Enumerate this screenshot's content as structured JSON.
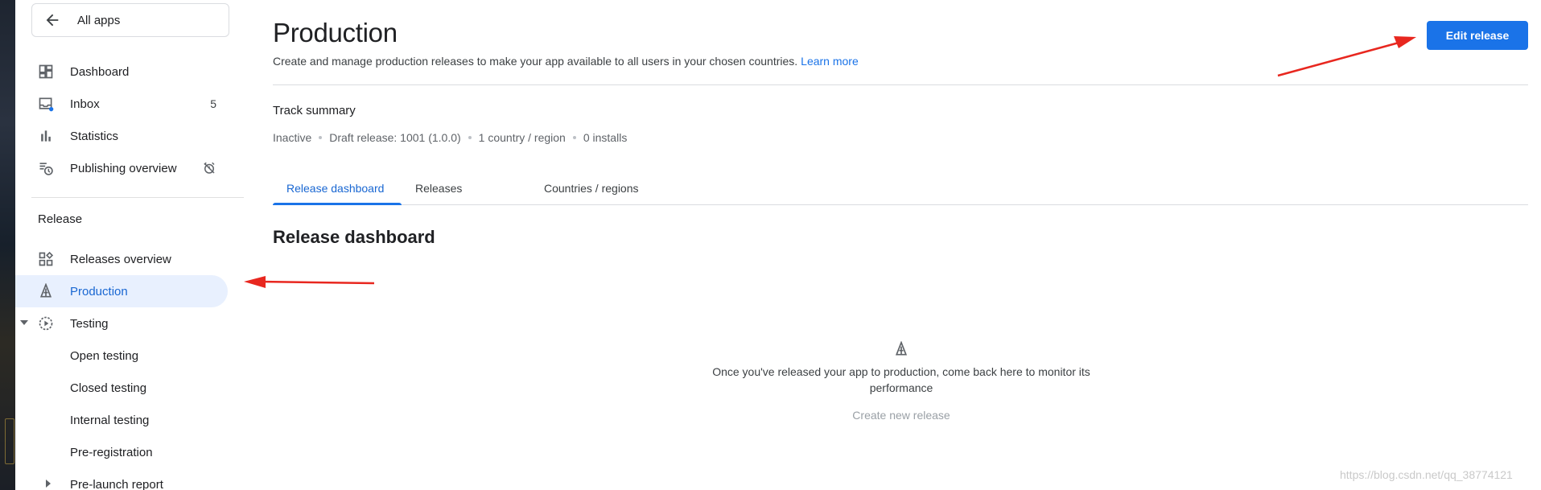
{
  "sidebar": {
    "all_apps": "All apps",
    "items": [
      {
        "label": "Dashboard",
        "icon": "dashboard-icon"
      },
      {
        "label": "Inbox",
        "icon": "inbox-icon",
        "badge": "5"
      },
      {
        "label": "Statistics",
        "icon": "bar-chart-icon"
      },
      {
        "label": "Publishing overview",
        "icon": "publishing-overview-icon"
      }
    ],
    "release_section": "Release",
    "release_items": [
      {
        "label": "Releases overview",
        "icon": "releases-overview-icon"
      },
      {
        "label": "Production",
        "icon": "production-icon",
        "active": true
      },
      {
        "label": "Testing",
        "icon": "testing-icon"
      },
      {
        "label": "Open testing"
      },
      {
        "label": "Closed testing"
      },
      {
        "label": "Internal testing"
      },
      {
        "label": "Pre-registration"
      },
      {
        "label": "Pre-launch report"
      }
    ]
  },
  "main": {
    "title": "Production",
    "subtitle": "Create and manage production releases to make your app available to all users in your chosen countries.",
    "learn_more": "Learn more",
    "edit_release": "Edit release",
    "track_summary": {
      "title": "Track summary",
      "status": "Inactive",
      "draft": "Draft release: 1001 (1.0.0)",
      "countries": "1 country / region",
      "installs": "0 installs"
    },
    "tabs": [
      {
        "label": "Release dashboard",
        "active": true
      },
      {
        "label": "Releases"
      },
      {
        "label": "Countries / regions"
      }
    ],
    "section_title": "Release dashboard",
    "empty_state": {
      "message": "Once you've released your app to production, come back here to monitor its performance",
      "action": "Create new release"
    }
  },
  "watermark": "https://blog.csdn.net/qq_38774121",
  "colors": {
    "accent": "#1a73e8",
    "active_bg": "#e8f0fe",
    "annotation_arrow": "#e8271f"
  }
}
